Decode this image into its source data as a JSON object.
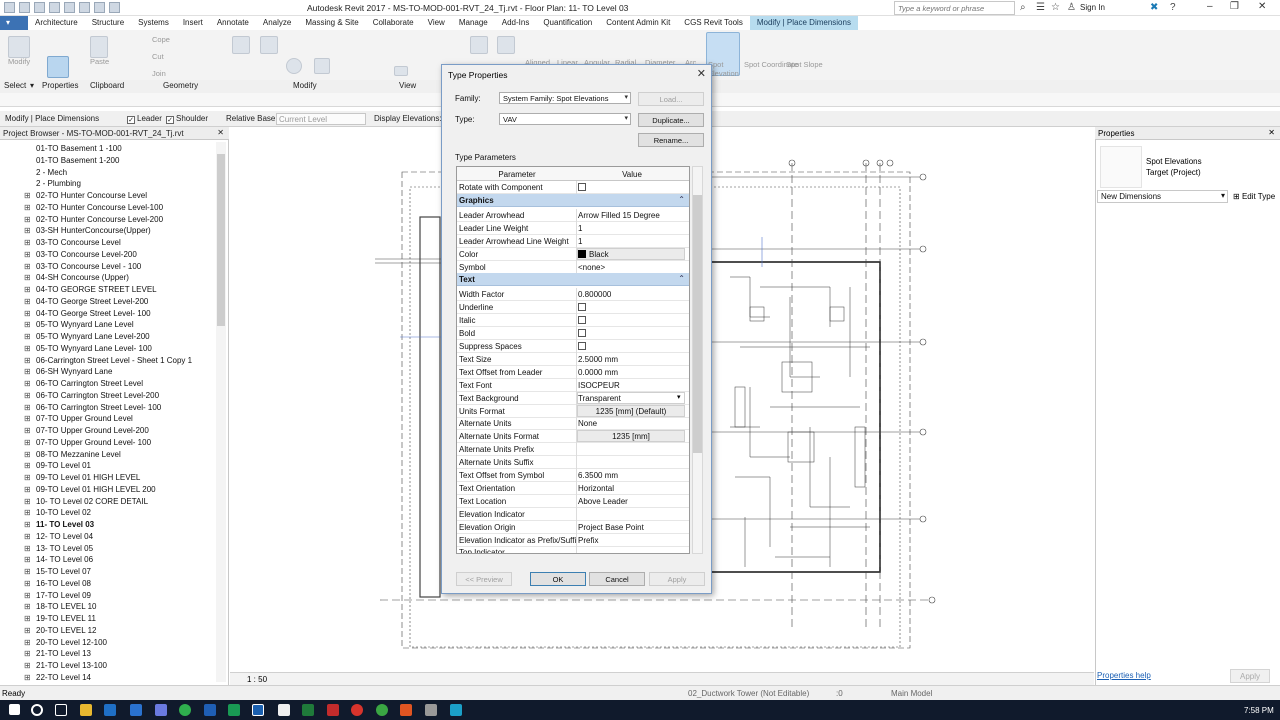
{
  "window": {
    "title": "Autodesk Revit 2017 -     MS-TO-MOD-001-RVT_24_Tj.rvt - Floor Plan: 11- TO Level 03",
    "search_placeholder": "Type a keyword or phrase",
    "sign_in": "Sign In"
  },
  "tabs": [
    "Architecture",
    "Structure",
    "Systems",
    "Insert",
    "Annotate",
    "Analyze",
    "Massing & Site",
    "Collaborate",
    "View",
    "Manage",
    "Add-Ins",
    "Quantification",
    "Content Admin Kit",
    "CGS Revit Tools",
    "Modify | Place Dimensions"
  ],
  "ribbon": {
    "groups": [
      "Select",
      "Properties",
      "Clipboard",
      "Geometry",
      "Modify",
      "View"
    ],
    "labels": {
      "modify": "Modify",
      "paste": "Paste",
      "cope": "Cope",
      "cut": "Cut",
      "join": "Join",
      "aligned": "Aligned",
      "linear": "Linear",
      "angular": "Angular",
      "radial": "Radial",
      "diameter": "Diameter",
      "arc": "Arc",
      "spot_elevation": "Spot Elevation",
      "spot_coordinate": "Spot Coordinate",
      "spot_slope": "Spot Slope"
    }
  },
  "options_bar": {
    "context": "Modify | Place Dimensions",
    "leader": "Leader",
    "shoulder": "Shoulder",
    "relative_base": "Relative Base:",
    "relative_base_value": "Current Level",
    "display_elevations": "Display Elevations:"
  },
  "project_browser": {
    "title": "Project Browser - MS-TO-MOD-001-RVT_24_Tj.rvt",
    "items": [
      "01-TO Basement 1 -100",
      "01-TO Basement 1-200",
      "2 - Mech",
      "2 - Plumbing",
      "02-TO Hunter Concourse Level",
      "02-TO Hunter Concourse Level-100",
      "02-TO Hunter Concourse Level-200",
      "03-SH HunterConcourse(Upper)",
      "03-TO Concourse Level",
      "03-TO Concourse Level-200",
      "03-TO Concourse Level - 100",
      "04-SH Concourse (Upper)",
      "04-TO GEORGE STREET LEVEL",
      "04-TO George Street Level-200",
      "04-TO George Street Level- 100",
      "05-TO Wynyard Lane Level",
      "05-TO Wynyard Lane Level-200",
      "05-TO Wynyard Lane Level- 100",
      "06-Carrington Street Level - Sheet 1 Copy 1",
      "06-SH Wynyard Lane",
      "06-TO Carrington Street Level",
      "06-TO Carrington Street Level-200",
      "06-TO Carrington Street Level- 100",
      "07-TO Upper Ground Level",
      "07-TO Upper Ground Level-200",
      "07-TO Upper Ground Level- 100",
      "08-TO Mezzanine Level",
      "09-TO Level 01",
      "09-TO Level 01 HIGH LEVEL",
      "09-TO Level 01 HIGH LEVEL 200",
      "10- TO Level 02 CORE DETAIL",
      "10-TO Level 02",
      "11- TO Level 03",
      "12- TO Level 04",
      "13- TO Level 05",
      "14- TO Level 06",
      "15-TO Level 07",
      "16-TO Level 08",
      "17-TO Level 09",
      "18-TO LEVEL 10",
      "19-TO LEVEL 11",
      "20-TO LEVEL 12",
      "20-TO Level 12-100",
      "21-TO Level 13",
      "21-TO Level 13-100",
      "22-TO Level 14"
    ]
  },
  "properties": {
    "title": "Properties",
    "family": "Spot Elevations",
    "type": "Target (Project)",
    "selector": "New Dimensions",
    "edit_type": "Edit Type",
    "help": "Properties help",
    "apply": "Apply"
  },
  "view_bar": {
    "scale": "1 : 50"
  },
  "status_bar": {
    "ready": "Ready",
    "workset": "02_Ductwork Tower (Not Editable)",
    "count": ":0",
    "model": "Main Model"
  },
  "taskbar": {
    "time": "7:58 PM"
  },
  "dialog": {
    "title": "Type Properties",
    "family_label": "Family:",
    "family_value": "System Family: Spot Elevations",
    "type_label": "Type:",
    "type_value": "VAV",
    "load": "Load...",
    "duplicate": "Duplicate...",
    "rename": "Rename...",
    "type_parameters": "Type Parameters",
    "col_parameter": "Parameter",
    "col_value": "Value",
    "rows": [
      {
        "p": "Rotate with Component",
        "kind": "check"
      },
      {
        "p": "Graphics",
        "kind": "group"
      },
      {
        "p": "Leader Arrowhead",
        "v": "Arrow Filled 15 Degree"
      },
      {
        "p": "Leader Line Weight",
        "v": "1"
      },
      {
        "p": "Leader Arrowhead Line Weight",
        "v": "1"
      },
      {
        "p": "Color",
        "v": "Black",
        "kind": "color"
      },
      {
        "p": "Symbol",
        "v": "<none>"
      },
      {
        "p": "Text",
        "kind": "group"
      },
      {
        "p": "Width Factor",
        "v": "0.800000"
      },
      {
        "p": "Underline",
        "kind": "check"
      },
      {
        "p": "Italic",
        "kind": "check"
      },
      {
        "p": "Bold",
        "kind": "check"
      },
      {
        "p": "Suppress Spaces",
        "kind": "check"
      },
      {
        "p": "Text Size",
        "v": "2.5000 mm"
      },
      {
        "p": "Text Offset from Leader",
        "v": "0.0000 mm"
      },
      {
        "p": "Text Font",
        "v": "ISOCPEUR"
      },
      {
        "p": "Text Background",
        "v": "Transparent",
        "kind": "select"
      },
      {
        "p": "Units Format",
        "v": "1235 [mm] (Default)",
        "kind": "button"
      },
      {
        "p": "Alternate Units",
        "v": "None"
      },
      {
        "p": "Alternate Units Format",
        "v": "1235 [mm]",
        "kind": "button"
      },
      {
        "p": "Alternate Units Prefix",
        "v": ""
      },
      {
        "p": "Alternate Units Suffix",
        "v": ""
      },
      {
        "p": "Text Offset from Symbol",
        "v": "6.3500 mm"
      },
      {
        "p": "Text Orientation",
        "v": "Horizontal"
      },
      {
        "p": "Text Location",
        "v": "Above Leader"
      },
      {
        "p": "Elevation Indicator",
        "v": ""
      },
      {
        "p": "Elevation Origin",
        "v": "Project Base Point"
      },
      {
        "p": "Elevation Indicator as Prefix/Suffix",
        "v": "Prefix"
      },
      {
        "p": "Top Indicator",
        "v": ""
      }
    ],
    "preview": "<< Preview",
    "ok": "OK",
    "cancel": "Cancel",
    "apply": "Apply"
  }
}
